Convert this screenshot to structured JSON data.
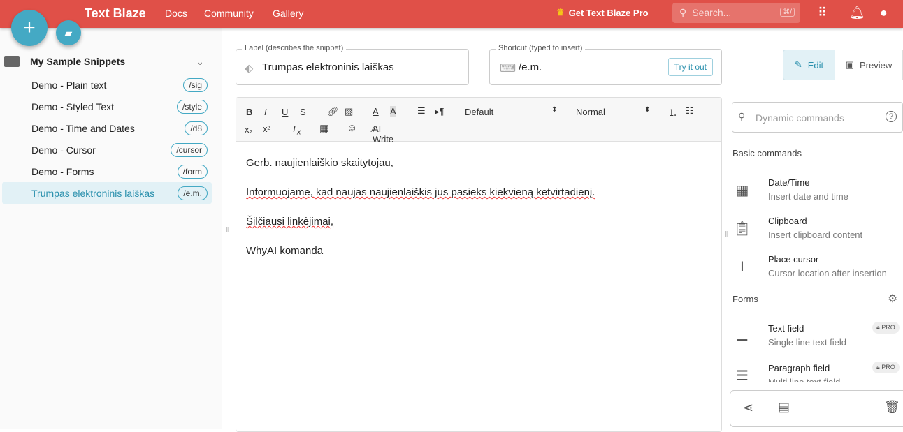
{
  "header": {
    "brand": "Text Blaze",
    "nav": [
      "Docs",
      "Community",
      "Gallery"
    ],
    "pro": "Get Text Blaze Pro",
    "search_placeholder": "Search...",
    "search_kbd": "⌘/"
  },
  "sidebar": {
    "folder": "My Sample Snippets",
    "items": [
      {
        "label": "Demo - Plain text",
        "shortcut": "/sig"
      },
      {
        "label": "Demo - Styled Text",
        "shortcut": "/style"
      },
      {
        "label": "Demo - Time and Dates",
        "shortcut": "/d8"
      },
      {
        "label": "Demo - Cursor",
        "shortcut": "/cursor"
      },
      {
        "label": "Demo - Forms",
        "shortcut": "/form"
      },
      {
        "label": "Trumpas elektroninis laiškas",
        "shortcut": "/e.m."
      }
    ]
  },
  "snippet": {
    "label_caption": "Label (describes the snippet)",
    "label_value": "Trumpas elektroninis laiškas",
    "shortcut_caption": "Shortcut (typed to insert)",
    "shortcut_value": "/e.m.",
    "try_label": "Try it out"
  },
  "modes": {
    "edit": "Edit",
    "preview": "Preview"
  },
  "toolbar": {
    "font": "Default",
    "size": "Normal",
    "ai": "AI Write"
  },
  "content": {
    "lines": [
      "Gerb. naujienlaiškio skaitytojau,",
      "Informuojame, kad naujas naujienlaiškis jus pasieks kiekvieną ketvirtadienį.",
      "Šilčiausi linkėjimai,",
      "WhyAI komanda"
    ]
  },
  "panel": {
    "search_placeholder": "Dynamic commands",
    "basic_title": "Basic commands",
    "forms_title": "Forms",
    "basic": [
      {
        "title": "Date/Time",
        "sub": "Insert date and time"
      },
      {
        "title": "Clipboard",
        "sub": "Insert clipboard content"
      },
      {
        "title": "Place cursor",
        "sub": "Cursor location after insertion"
      }
    ],
    "forms": [
      {
        "title": "Text field",
        "sub": "Single line text field",
        "badge": "PRO"
      },
      {
        "title": "Paragraph field",
        "sub": "Multi line text field",
        "badge": "PRO"
      }
    ]
  }
}
